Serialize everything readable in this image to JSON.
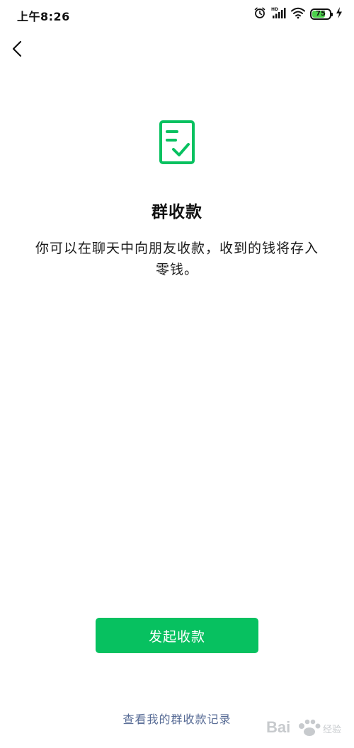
{
  "status_bar": {
    "time": "上午8:26",
    "battery_level": "75",
    "battery_fraction": 0.75,
    "icons": [
      "alarm-icon",
      "hd-signal-icon",
      "wifi-icon",
      "battery-icon",
      "charging-icon"
    ]
  },
  "nav": {
    "back_icon": "chevron-left-icon"
  },
  "main": {
    "icon": "document-check-icon",
    "title": "群收款",
    "description": "你可以在聊天中向朋友收款，收到的钱将存入零钱。",
    "primary_button_label": "发起收款",
    "records_link_label": "查看我的群收款记录"
  },
  "colors": {
    "accent": "#07c160",
    "link": "#576b95"
  },
  "watermark": {
    "text": "Bai 经验"
  }
}
